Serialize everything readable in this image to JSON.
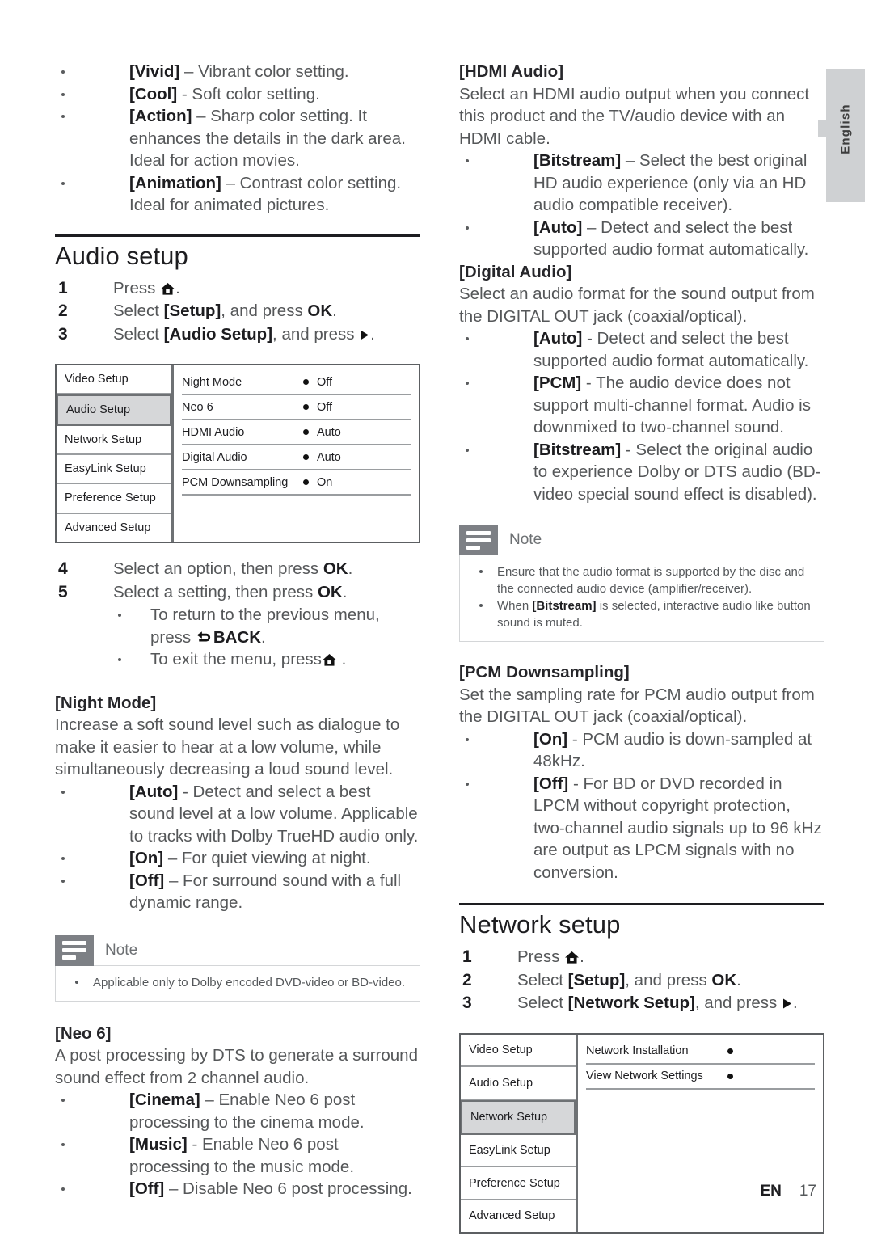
{
  "page": {
    "language_tab": "English",
    "footer_code": "EN",
    "footer_page": "17"
  },
  "left_column": {
    "video_preset_bullets": [
      {
        "term": "[Vivid]",
        "text": " – Vibrant color setting."
      },
      {
        "term": "[Cool]",
        "text": " - Soft color setting."
      },
      {
        "term": "[Action]",
        "text": " – Sharp color setting. It enhances the details in the dark area. Ideal for action movies."
      },
      {
        "term": "[Animation]",
        "text": " – Contrast color setting. Ideal for animated pictures."
      }
    ],
    "audio_setup": {
      "heading": "Audio setup",
      "steps": [
        {
          "num": "1",
          "pre": "Press ",
          "icon": "home-icon",
          "post": "."
        },
        {
          "num": "2",
          "pre": "Select ",
          "bold": "[Setup]",
          "mid": ", and press ",
          "bold2": "OK",
          "post": "."
        },
        {
          "num": "3",
          "pre": "Select ",
          "bold": "[Audio Setup]",
          "mid": ", and press ",
          "icon": "right-arrow-icon",
          "post": "."
        }
      ],
      "menu": {
        "left_items": [
          {
            "label": "Video Setup",
            "selected": false
          },
          {
            "label": "Audio Setup",
            "selected": true
          },
          {
            "label": "Network Setup",
            "selected": false
          },
          {
            "label": "EasyLink Setup",
            "selected": false
          },
          {
            "label": "Preference Setup",
            "selected": false
          },
          {
            "label": "Advanced Setup",
            "selected": false
          }
        ],
        "rows": [
          {
            "label": "Night Mode",
            "value": "Off"
          },
          {
            "label": "Neo 6",
            "value": "Off"
          },
          {
            "label": "HDMI Audio",
            "value": "Auto"
          },
          {
            "label": "Digital Audio",
            "value": "Auto"
          },
          {
            "label": "PCM Downsampling",
            "value": "On"
          }
        ]
      },
      "steps2": [
        {
          "num": "4",
          "pre": "Select an option, then press ",
          "bold2": "OK",
          "post": "."
        },
        {
          "num": "5",
          "pre": "Select a setting, then press ",
          "bold2": "OK",
          "post": "."
        }
      ],
      "substeps": [
        {
          "pre": "To return to the previous menu, press ",
          "icon": "back-icon",
          "bold": "BACK",
          "post": "."
        },
        {
          "pre": "To exit the menu, press",
          "icon": "home-icon",
          "post": " ."
        }
      ]
    },
    "night_mode": {
      "heading": "[Night Mode]",
      "body": "Increase a soft sound level such as dialogue to make it easier to hear at a low volume, while simultaneously decreasing a loud sound level.",
      "bullets": [
        {
          "term": "[Auto]",
          "text": " - Detect and select a best sound level at a low volume. Applicable to tracks with Dolby TrueHD audio only."
        },
        {
          "term": "[On]",
          "text": " – For quiet viewing at night."
        },
        {
          "term": "[Off]",
          "text": " – For surround sound with a full dynamic range."
        }
      ],
      "note": {
        "title": "Note",
        "items": [
          {
            "pre": "Applicable only to Dolby encoded DVD-video or BD-video."
          }
        ]
      }
    },
    "neo6": {
      "heading": "[Neo 6]",
      "body": "A post processing by DTS to generate a surround sound effect from 2 channel audio.",
      "bullets": [
        {
          "term": "[Cinema]",
          "text": " – Enable Neo 6 post processing to the cinema mode."
        },
        {
          "term": "[Music]",
          "text": " - Enable Neo 6 post processing to the music mode."
        },
        {
          "term": "[Off]",
          "text": " – Disable Neo 6 post processing."
        }
      ]
    }
  },
  "right_column": {
    "hdmi_audio": {
      "heading": "[HDMI Audio]",
      "body": "Select an HDMI audio output when you connect this product and the TV/audio device with an HDMI cable.",
      "bullets": [
        {
          "term": "[Bitstream]",
          "text": " – Select the best original HD audio experience (only via an HD audio compatible receiver)."
        },
        {
          "term": "[Auto]",
          "text": " – Detect and select the best supported audio format automatically."
        }
      ]
    },
    "digital_audio": {
      "heading": "[Digital Audio]",
      "body": "Select an audio format for the sound output from the DIGITAL OUT jack (coaxial/optical).",
      "bullets": [
        {
          "term": "[Auto]",
          "text": " - Detect and select the best supported audio format automatically."
        },
        {
          "term": "[PCM]",
          "text": " - The audio device does not support multi-channel format. Audio is downmixed to two-channel sound."
        },
        {
          "term": "[Bitstream]",
          "text": " - Select the original audio to experience Dolby or DTS audio (BD-video special sound effect is disabled)."
        }
      ],
      "note": {
        "title": "Note",
        "items": [
          {
            "pre": "Ensure that the audio format is supported by the disc and the connected audio device (amplifier/receiver)."
          },
          {
            "pre": "When ",
            "bold": "[Bitstream]",
            "post": " is selected, interactive audio like button sound is muted."
          }
        ]
      }
    },
    "pcm_downsampling": {
      "heading": "[PCM Downsampling]",
      "body": "Set the sampling rate for PCM audio output from the DIGITAL OUT jack (coaxial/optical).",
      "bullets": [
        {
          "term": "[On]",
          "text": " - PCM audio is down-sampled at 48kHz."
        },
        {
          "term": "[Off]",
          "text": " - For BD or DVD recorded in LPCM without copyright protection, two-channel audio signals up to 96 kHz are output as LPCM signals with no conversion."
        }
      ]
    },
    "network_setup": {
      "heading": "Network setup",
      "steps": [
        {
          "num": "1",
          "pre": "Press ",
          "icon": "home-icon",
          "post": "."
        },
        {
          "num": "2",
          "pre": "Select ",
          "bold": "[Setup]",
          "mid": ", and press ",
          "bold2": "OK",
          "post": "."
        },
        {
          "num": "3",
          "pre": "Select ",
          "bold": "[Network Setup]",
          "mid": ", and press ",
          "icon": "right-arrow-icon",
          "post": "."
        }
      ],
      "menu": {
        "left_items": [
          {
            "label": "Video Setup",
            "selected": false
          },
          {
            "label": "Audio Setup",
            "selected": false
          },
          {
            "label": "Network Setup",
            "selected": true
          },
          {
            "label": "EasyLink Setup",
            "selected": false
          },
          {
            "label": "Preference Setup",
            "selected": false
          },
          {
            "label": "Advanced Setup",
            "selected": false
          }
        ],
        "rows": [
          {
            "label": "Network Installation",
            "value": ""
          },
          {
            "label": "View Network Settings",
            "value": ""
          }
        ]
      }
    }
  }
}
